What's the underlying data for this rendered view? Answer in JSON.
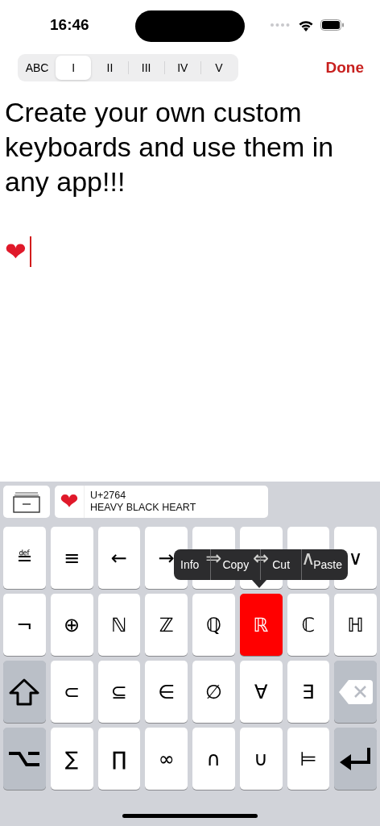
{
  "status_bar": {
    "time": "16:46"
  },
  "segments": [
    {
      "label": "ABC",
      "selected": false
    },
    {
      "label": "I",
      "selected": true
    },
    {
      "label": "II",
      "selected": false
    },
    {
      "label": "III",
      "selected": false
    },
    {
      "label": "IV",
      "selected": false
    },
    {
      "label": "V",
      "selected": false
    }
  ],
  "done": "Done",
  "editor": {
    "body": "Create your own custom keyboards and use them in any app!!!",
    "typed": "❤"
  },
  "suggestion": {
    "glyph": "❤",
    "code": "U+2764",
    "name": "HEAVY BLACK HEART"
  },
  "keys": [
    [
      {
        "kind": "char",
        "label": "≝",
        "selected": false
      },
      {
        "kind": "char",
        "label": "≡",
        "selected": false
      },
      {
        "kind": "char",
        "label": "←",
        "selected": false
      },
      {
        "kind": "char",
        "label": "→",
        "selected": false
      },
      {
        "kind": "char",
        "label": "⇒",
        "selected": false
      },
      {
        "kind": "char",
        "label": "⇔",
        "selected": false
      },
      {
        "kind": "char",
        "label": "∧",
        "selected": false
      },
      {
        "kind": "char",
        "label": "∨",
        "selected": false
      }
    ],
    [
      {
        "kind": "char",
        "label": "¬",
        "selected": false
      },
      {
        "kind": "char",
        "label": "⊕",
        "selected": false
      },
      {
        "kind": "char",
        "label": "ℕ",
        "selected": false
      },
      {
        "kind": "char",
        "label": "ℤ",
        "selected": false
      },
      {
        "kind": "char",
        "label": "ℚ",
        "selected": false
      },
      {
        "kind": "char",
        "label": "ℝ",
        "selected": true
      },
      {
        "kind": "char",
        "label": "ℂ",
        "selected": false
      },
      {
        "kind": "char",
        "label": "ℍ",
        "selected": false
      }
    ],
    [
      {
        "kind": "shift",
        "selected": false
      },
      {
        "kind": "char",
        "label": "⊂",
        "selected": false
      },
      {
        "kind": "char",
        "label": "⊆",
        "selected": false
      },
      {
        "kind": "char",
        "label": "∈",
        "selected": false
      },
      {
        "kind": "char",
        "label": "∅",
        "selected": false
      },
      {
        "kind": "char",
        "label": "∀",
        "selected": false
      },
      {
        "kind": "char",
        "label": "∃",
        "selected": false
      },
      {
        "kind": "delete",
        "selected": false
      }
    ],
    [
      {
        "kind": "option",
        "selected": false
      },
      {
        "kind": "char",
        "label": "∑",
        "selected": false
      },
      {
        "kind": "char",
        "label": "∏",
        "selected": false
      },
      {
        "kind": "char",
        "label": "∞",
        "selected": false
      },
      {
        "kind": "char",
        "label": "∩",
        "selected": false
      },
      {
        "kind": "char",
        "label": "∪",
        "selected": false
      },
      {
        "kind": "char",
        "label": "⊨",
        "selected": false
      },
      {
        "kind": "return",
        "selected": false
      }
    ]
  ],
  "popup": {
    "items": [
      "Info",
      "Copy",
      "Cut",
      "Paste"
    ]
  }
}
